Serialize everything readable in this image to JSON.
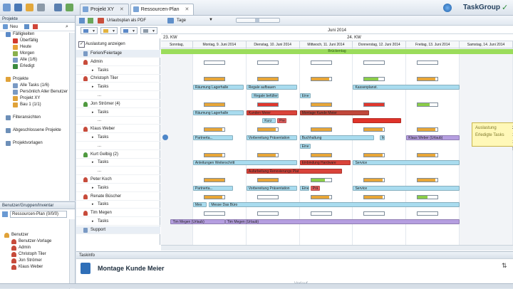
{
  "tabs": [
    {
      "label": "Projekt XY",
      "close": "✕"
    },
    {
      "label": "Ressourcen-Plan",
      "close": "✕"
    }
  ],
  "brand": "TaskGroup",
  "leftnav": {
    "header": "Projekte",
    "new_label": "Neu",
    "items": [
      {
        "label": "Fälligkeiten",
        "indent": 1,
        "color": "#5b8ac8"
      },
      {
        "label": "Überfällig",
        "indent": 2,
        "color": "#d23b2e"
      },
      {
        "label": "Heute",
        "indent": 2,
        "color": "#e7a33a"
      },
      {
        "label": "Morgen",
        "indent": 2,
        "color": "#8ab04c"
      },
      {
        "label": "Alle (1/6)",
        "indent": 2,
        "color": "#7a9ac4"
      },
      {
        "label": "Erledigt",
        "indent": 2,
        "color": "#3b8a3e"
      },
      {
        "label": "",
        "indent": 0,
        "color": ""
      },
      {
        "label": "Projekte",
        "indent": 1,
        "color": "#e0a239"
      },
      {
        "label": "Alle Tasks (1/6)",
        "indent": 2,
        "color": "#7a9ac4"
      },
      {
        "label": "Persönlich Aller Benutzer",
        "indent": 2,
        "color": "#7a9ac4"
      },
      {
        "label": "Projekt XY",
        "indent": 2,
        "color": "#e0a239"
      },
      {
        "label": "Bau 1 (1/1)",
        "indent": 2,
        "color": "#e0a239"
      },
      {
        "label": "",
        "indent": 0,
        "color": ""
      },
      {
        "label": "Filteransichten",
        "indent": 1,
        "color": "#6d8fb8"
      },
      {
        "label": "",
        "indent": 0,
        "color": ""
      },
      {
        "label": "Abgeschlossene Projekte",
        "indent": 1,
        "color": "#6d8fb8"
      },
      {
        "label": "",
        "indent": 0,
        "color": ""
      },
      {
        "label": "Projektvorlagen",
        "indent": 1,
        "color": "#6d8fb8"
      }
    ]
  },
  "leftlow": {
    "header": "Benutzer/Gruppen/Inventar",
    "combo": "Ressourcen-Plan (0/0/0)",
    "items": [
      {
        "label": "Benutzer",
        "indent": 1
      },
      {
        "label": "Benutzer-Vorlage",
        "indent": 2
      },
      {
        "label": "Admin",
        "indent": 2
      },
      {
        "label": "Christoph Tiler",
        "indent": 2
      },
      {
        "label": "Jon Strömer",
        "indent": 2
      },
      {
        "label": "Klaus Weber",
        "indent": 2
      }
    ]
  },
  "toolbar": {
    "urlaubsplan": "Urlaubsplan als PDF",
    "tage": "Tage"
  },
  "rows": {
    "caption": "Auslastung anzeigen",
    "list": [
      {
        "label": "Ferien/Feiertage",
        "type": "group"
      },
      {
        "label": "Admin",
        "type": "user"
      },
      {
        "label": "Tasks",
        "type": "sub"
      },
      {
        "label": "Christoph Tiler",
        "type": "user"
      },
      {
        "label": "Tasks",
        "type": "sub"
      },
      {
        "label": "...",
        "type": "sub"
      },
      {
        "label": "Jon Strömer (4)",
        "type": "user"
      },
      {
        "label": "Tasks",
        "type": "sub"
      },
      {
        "label": "...",
        "type": "sub"
      },
      {
        "label": "Klaus Weber",
        "type": "user"
      },
      {
        "label": "Tasks",
        "type": "sub"
      },
      {
        "label": "...",
        "type": "sub"
      },
      {
        "label": "Kurt Gelbig (2)",
        "type": "user"
      },
      {
        "label": "Tasks",
        "type": "sub"
      },
      {
        "label": "...",
        "type": "sub"
      },
      {
        "label": "Peter Koch",
        "type": "user"
      },
      {
        "label": "Tasks",
        "type": "sub"
      },
      {
        "label": "Renate Büscher",
        "type": "user"
      },
      {
        "label": "Tasks",
        "type": "sub"
      },
      {
        "label": "Tim Megen",
        "type": "user"
      },
      {
        "label": "Tasks",
        "type": "sub"
      },
      {
        "label": "Support",
        "type": "group"
      }
    ]
  },
  "gantt": {
    "month": "Juni 2014",
    "weeks": [
      {
        "label": "23. KW"
      },
      {
        "label": "24. KW"
      }
    ],
    "days": [
      {
        "label": "Sonntag,",
        "weekend": true
      },
      {
        "label": "Montag, 9. Juni 2014",
        "weekend": false
      },
      {
        "label": "Dienstag, 10. Juni 2014",
        "weekend": false
      },
      {
        "label": "Mittwoch, 11. Juni 2014",
        "weekend": false
      },
      {
        "label": "Donnerstag, 12. Juni 2014",
        "weekend": false
      },
      {
        "label": "Freitag, 13. Juni 2014",
        "weekend": false
      },
      {
        "label": "Samstag, 14. Juni 2014",
        "weekend": true
      }
    ],
    "holiday": "Brückentag",
    "tasks": [
      {
        "label": "Räumung Lagerhalle",
        "row": 4,
        "start": 1,
        "end": 1.95,
        "color": "#a9dcef"
      },
      {
        "label": "Regale aufbauen",
        "row": 4,
        "start": 2,
        "end": 2.95,
        "color": "#a9dcef"
      },
      {
        "label": "Kassenplanst.",
        "row": 4,
        "start": 4,
        "end": 6,
        "color": "#a9dcef"
      },
      {
        "label": "Regale befüllen",
        "row": 5,
        "start": 2.1,
        "end": 2.6,
        "color": "#a9dcef"
      },
      {
        "label": "Eine",
        "row": 5,
        "start": 3,
        "end": 3.2,
        "color": "#a9dcef"
      },
      {
        "label": "Räumung Lagerhalle",
        "row": 7,
        "start": 1,
        "end": 1.95,
        "color": "#a9dcef"
      },
      {
        "label": "Kunden Meier",
        "row": 7,
        "start": 2,
        "end": 2.95,
        "color": "#d9433a"
      },
      {
        "label": "Montage Kunde Meier",
        "row": 7,
        "start": 3,
        "end": 4.3,
        "color": "#c0473b"
      },
      {
        "label": "Kurz",
        "row": 8,
        "start": 2.3,
        "end": 2.55,
        "color": "#a9dcef"
      },
      {
        "label": "Pre",
        "row": 8,
        "start": 2.58,
        "end": 2.75,
        "color": "#e46060"
      },
      {
        "label": "",
        "row": 8,
        "start": 4,
        "end": 4.9,
        "color": "#e0332a"
      },
      {
        "label": "Partnerta...",
        "row": 10,
        "start": 1,
        "end": 1.75,
        "color": "#a9dcef"
      },
      {
        "label": "Vorbereitung Präsentation",
        "row": 10,
        "start": 2,
        "end": 2.95,
        "color": "#a9dcef"
      },
      {
        "label": "Buchhaltung",
        "row": 10,
        "start": 3,
        "end": 4.4,
        "color": "#a9dcef"
      },
      {
        "label": "M",
        "row": 10,
        "start": 4.5,
        "end": 4.6,
        "color": "#a9dcef"
      },
      {
        "label": "Klaus Weber (Urlaub)",
        "row": 10,
        "start": 5,
        "end": 6,
        "color": "#b59ee0"
      },
      {
        "label": "Eine",
        "row": 11,
        "start": 3,
        "end": 3.2,
        "color": "#a9dcef"
      },
      {
        "label": "Anleitungen Weiterschritt",
        "row": 13,
        "start": 1,
        "end": 2.95,
        "color": "#a9dcef"
      },
      {
        "label": "Einbindung Hardware",
        "row": 13,
        "start": 3,
        "end": 3.95,
        "color": "#d9433a"
      },
      {
        "label": "Service",
        "row": 13,
        "start": 4,
        "end": 6,
        "color": "#a9dcef"
      },
      {
        "label": "Aufarbeitung Renovierungs Plat",
        "row": 14,
        "start": 2,
        "end": 3.8,
        "color": "#d9433a"
      },
      {
        "label": "Partnerta...",
        "row": 16,
        "start": 1,
        "end": 1.75,
        "color": "#a9dcef"
      },
      {
        "label": "Vorbereitung Präsentation",
        "row": 16,
        "start": 2,
        "end": 2.95,
        "color": "#a9dcef"
      },
      {
        "label": "Eine",
        "row": 16,
        "start": 3,
        "end": 3.18,
        "color": "#a9dcef"
      },
      {
        "label": "Prä",
        "row": 16,
        "start": 3.2,
        "end": 3.38,
        "color": "#e46060"
      },
      {
        "label": "Service",
        "row": 16,
        "start": 4,
        "end": 6,
        "color": "#a9dcef"
      },
      {
        "label": "Mes",
        "row": 18,
        "start": 1,
        "end": 1.25,
        "color": "#a9dcef"
      },
      {
        "label": "Messe Das Büro",
        "row": 18,
        "start": 1.3,
        "end": 6,
        "color": "#a9dcef"
      },
      {
        "label": "Tim Megen (Urlaub)",
        "row": 20,
        "start": 0.3,
        "end": 1.6,
        "color": "#b59ee0"
      },
      {
        "label": "Tim Megen (Urlaub)",
        "row": 20,
        "start": 1.6,
        "end": 6,
        "color": "#b59ee0"
      }
    ],
    "capacity": [
      {
        "row": 1,
        "cells": [
          0,
          0,
          0,
          0,
          0
        ]
      },
      {
        "row": 3,
        "cells": [
          1,
          1,
          0.9,
          0.7,
          0.9
        ]
      },
      {
        "row": 6,
        "cells": [
          1,
          2,
          1,
          2,
          0.6
        ]
      },
      {
        "row": 9,
        "cells": [
          0.9,
          0.9,
          1,
          0.9,
          0.9
        ]
      },
      {
        "row": 12,
        "cells": [
          0.9,
          0.9,
          1,
          0.9,
          0.9
        ]
      },
      {
        "row": 15,
        "cells": [
          1,
          1,
          0.7,
          0.9,
          0.9
        ]
      },
      {
        "row": 17,
        "cells": [
          0.9,
          0,
          0.9,
          0.9,
          0.5
        ]
      },
      {
        "row": 19,
        "cells": [
          0,
          0,
          0,
          0,
          0
        ]
      }
    ],
    "tooltip": {
      "rows": [
        {
          "k": "Auslastung",
          "v": "200%"
        },
        {
          "k": "Erledigte Tasks",
          "v": "100% Montage Kunde Meier"
        },
        {
          "k": "",
          "v": "100% Montage Kunde Schmidt"
        }
      ]
    }
  },
  "info": {
    "header": "Taskinfo",
    "title": "Montage Kunde Meier",
    "verlauf": "Verlauf"
  }
}
